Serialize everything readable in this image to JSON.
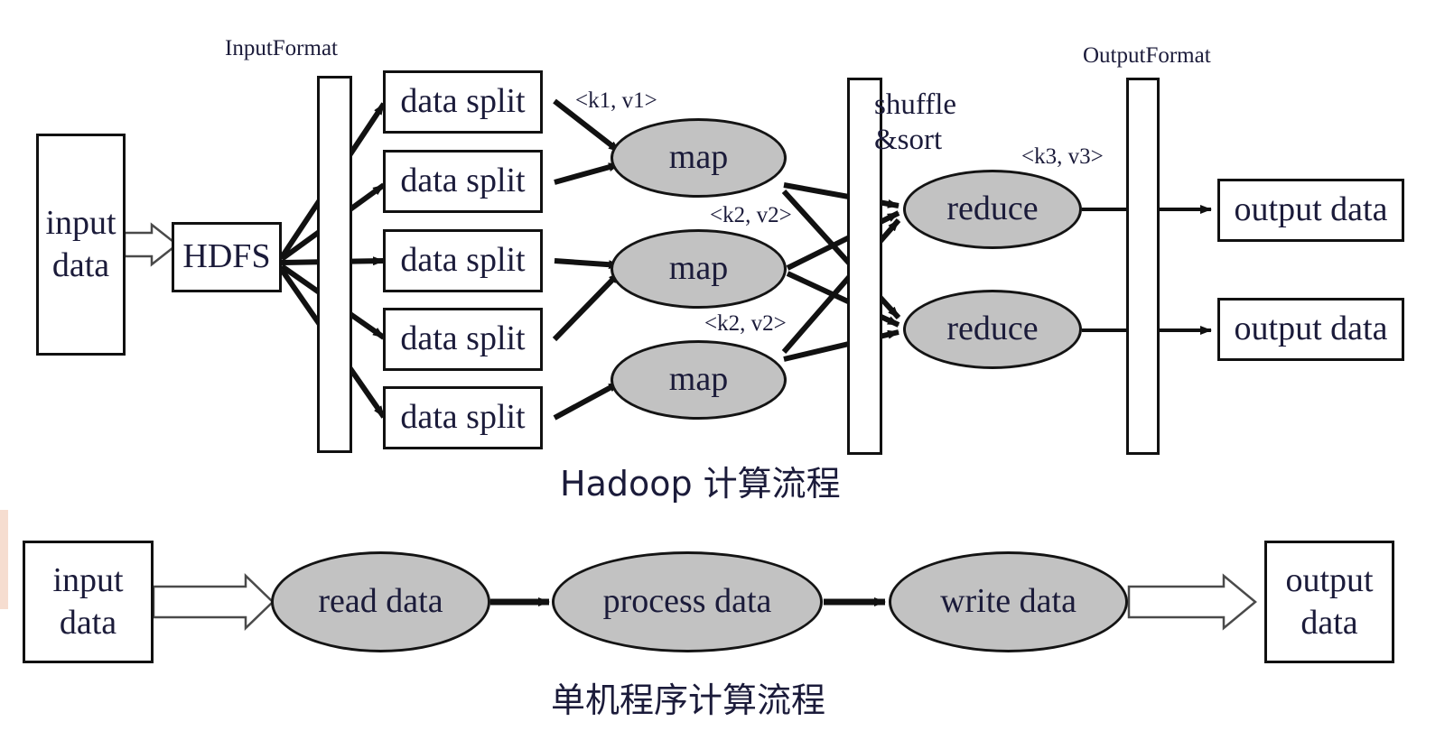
{
  "diagram": {
    "title_top": "Hadoop 计算流程",
    "title_bottom": "单机程序计算流程",
    "colors": {
      "stroke": "#111111",
      "ellipse_fill": "#c2c2c2",
      "rect_fill": "#ffffff",
      "text": "#1b1b3a",
      "background": "#ffffff"
    }
  },
  "top_flow": {
    "stage_labels": {
      "input_format": "InputFormat",
      "output_format": "OutputFormat",
      "shuffle_line1": "shuffle",
      "shuffle_line2": "&sort"
    },
    "input_box": {
      "line1": "input",
      "line2": "data"
    },
    "hdfs_box": {
      "label": "HDFS"
    },
    "data_splits": [
      {
        "label": "data split"
      },
      {
        "label": "data split"
      },
      {
        "label": "data split"
      },
      {
        "label": "data split"
      },
      {
        "label": "data split"
      }
    ],
    "maps": [
      {
        "label": "map"
      },
      {
        "label": "map"
      },
      {
        "label": "map"
      }
    ],
    "reduces": [
      {
        "label": "reduce"
      },
      {
        "label": "reduce"
      }
    ],
    "outputs": [
      {
        "label": "output data"
      },
      {
        "label": "output data"
      }
    ],
    "kv_labels": [
      {
        "name": "k1v1",
        "text": "<k1, v1>"
      },
      {
        "name": "k2v2-upper",
        "text": "<k2, v2>"
      },
      {
        "name": "k2v2-lower",
        "text": "<k2, v2>"
      },
      {
        "name": "k3v3",
        "text": "<k3, v3>"
      }
    ]
  },
  "bottom_flow": {
    "input_box": {
      "line1": "input",
      "line2": "data"
    },
    "stages": [
      {
        "label": "read data"
      },
      {
        "label": "process data"
      },
      {
        "label": "write data"
      }
    ],
    "output_box": {
      "line1": "output",
      "line2": "data"
    }
  }
}
